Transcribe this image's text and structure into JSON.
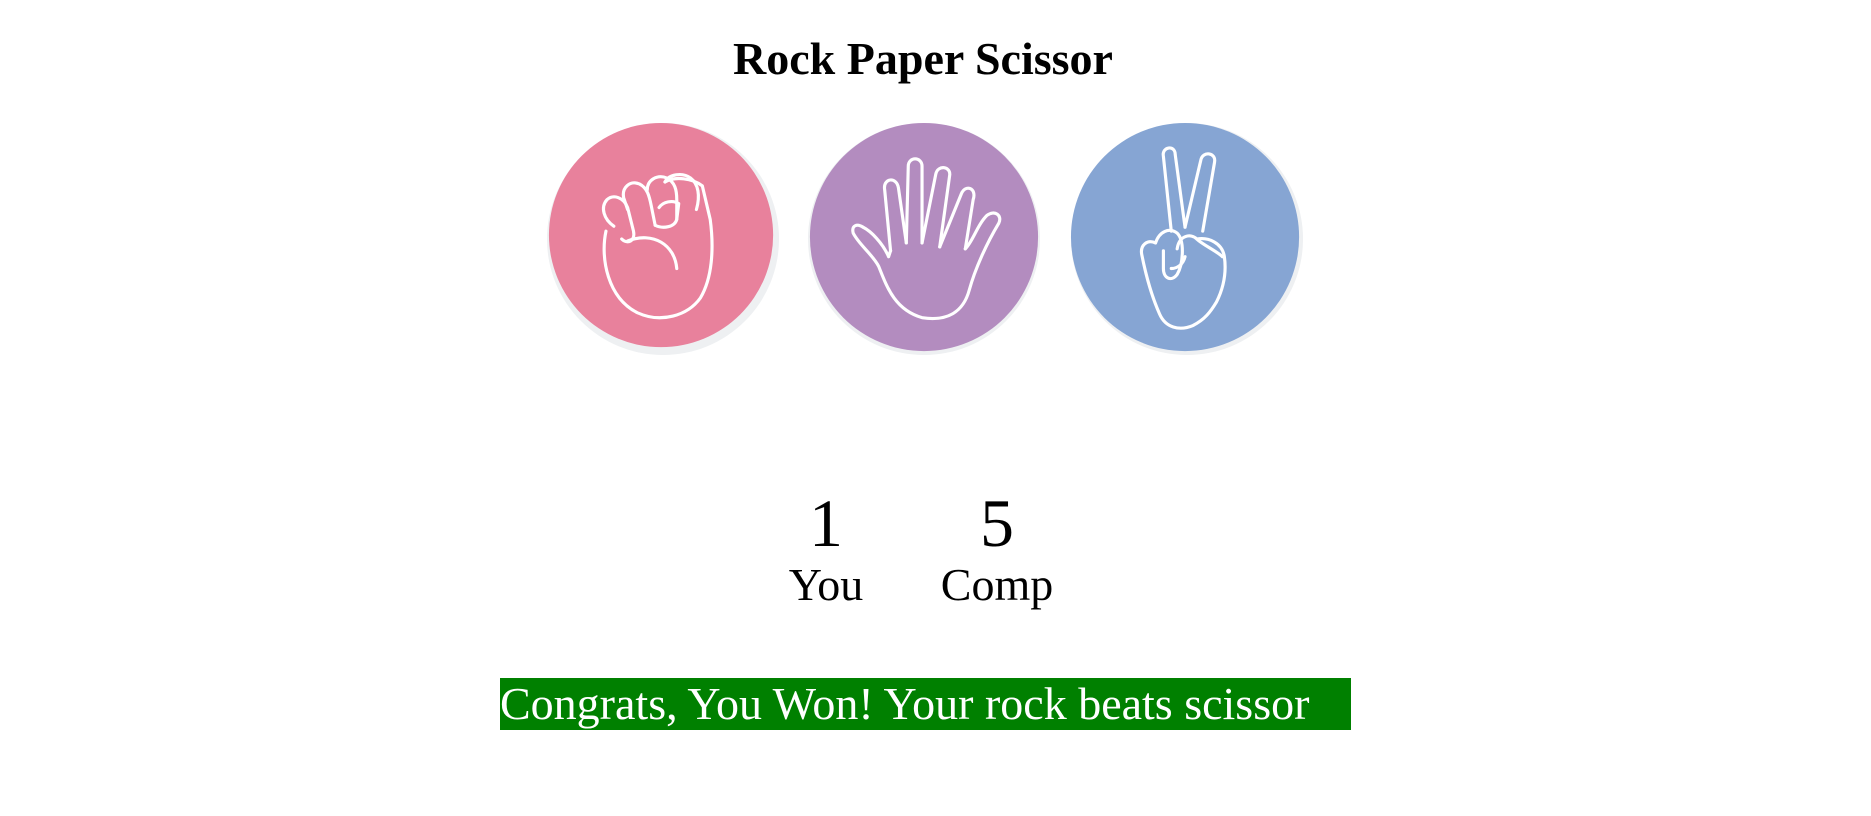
{
  "game": {
    "title": "Rock Paper Scissor",
    "choices": [
      {
        "id": "rock",
        "icon": "fist-icon",
        "color": "#e8819c"
      },
      {
        "id": "paper",
        "icon": "open-hand-icon",
        "color": "#b38cbf"
      },
      {
        "id": "scissor",
        "icon": "peace-sign-icon",
        "color": "#86a5d3"
      }
    ]
  },
  "scoreboard": {
    "user_score": "1",
    "user_label": "You",
    "comp_score": "5",
    "comp_label": "Comp"
  },
  "message": {
    "text": "Congrats, You Won! Your rock beats scissor",
    "bg_color": "#008000",
    "text_color": "#ffffff"
  }
}
